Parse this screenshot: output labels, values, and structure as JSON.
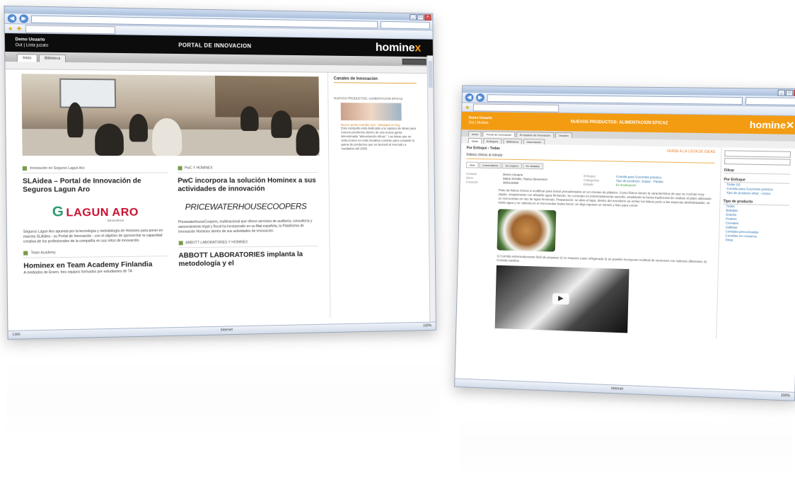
{
  "window1": {
    "user_name": "Demo Usuario",
    "user_links": "Out | Lista juzato",
    "portal_title": "PORTAL DE INNOVACION",
    "logo": "homine",
    "logo_mark": "x",
    "tabs": [
      "Inicio",
      "Biblioteca"
    ],
    "status_left": "Listo",
    "status_zone": "Internet",
    "zoom": "100%",
    "col1": {
      "category": "Innovación en Seguros Lagun Aro",
      "title": "SLAidea – Portal de Innovación de Seguros Lagun Aro",
      "brand": "LAGUN ARO",
      "brand_sub": "SEGUROS",
      "text": "Seguros Lagun Aro apuesta por la tecnología y metodología de Hominex para poner en marcha SLAidea - su Portal de Innovación - con el objetivo de aprovechar la capacidad creativa de los profesionales de la compañía en sus retos de innovación.",
      "category2": "Team Academy",
      "title2": "Hominex en Team Academy Finlandia",
      "text2": "A mediados de Enero, tres equipos formados por estudiantes de TA"
    },
    "col2": {
      "category": "PwC Y HOMINEX",
      "title": "PwC incorpora la solución Hominex a sus actividades de innovación",
      "brand": "PRICEWATERHOUSECOOPERS",
      "text": "PricewaterhouseCoopers, multinacional que ofrece servicios de auditoría, consultoría y asesoramiento legal y fiscal ha incorporado en su filial española, la Plataforma de Innovación Hominex dentro de sus actividades de innovación.",
      "category2": "ABBOTT LABORATORIES Y HOMINEX",
      "title2": "ABBOTT LABORATORIES implanta la metodología y el"
    },
    "sidebar": {
      "title": "Canales de Innovación",
      "item": "NUEVOS PRODUCTOS: ALIMENTACION EFICAZ",
      "link": "Nuevo punto Cambio Aún - Nevaqué es hoy",
      "text": "Esta campaña está dedicada a la captura de ideas para nuevos productos dentro de una nueva gama denominada \"alimentación eficaz\". Las ideas que se seleccionen en esta iniciativa cuentan para competir la gama de productos que se lanzará al mercado a mediados del 2009."
    }
  },
  "window2": {
    "user_name": "Demo Usuario",
    "user_links": "Out | Mislista",
    "portal_title": "NUEVOS PRODUCTOS: ALIMENTACION EFICAZ",
    "logo": "homine",
    "tabs": [
      "Inicio",
      "Portal de Innovación",
      "El espacio de innovación",
      "Desafío"
    ],
    "subtabs": [
      "Ideas",
      "Enfoques",
      "Biblioteca",
      "Información"
    ],
    "crumb": "Por Enfoque › Todas",
    "crumb_right": "VERSE A LA LISTA DE IDEAS",
    "idea_title": "Fideos chinos al minuto",
    "mini_tabs": [
      "Idea",
      "Comentarios",
      "En espera",
      "En detalles"
    ],
    "fields": [
      {
        "label": "Creador",
        "value": "Demo Usuario",
        "label2": "Enfoque",
        "value2": "Comida para Gourmets práctica"
      },
      {
        "label": "Otros",
        "value": "Maria Scholtz, Rama Stevenson",
        "label2": "Categorías",
        "value2": "Tipo de producto: Sopas · Pastas"
      },
      {
        "label": "Creación",
        "value": "30/01/2009",
        "label2": "Estado",
        "value2": "En Evaluación"
      }
    ],
    "description": "Plato de fideos chinos a modificar para tomar precalentados en un envase de plástico. Como fideos tienen la característica de que se cocinan muy rápido, simplemente con añadirle agua hirviendo. Su cocinado es extremadamente sencillo, ampliando la forma tradicional de realizar el plato utilizando un microondas en vez de agua hirviendo. Preparación: se abre el tapa, dentro del envoltorio se echan los fideos junto a las especias deshidratadas, se vierte agua y se calienta en el microondas hasta hervir, se deja reposar un minuto y listo para comer.",
    "more_text": "1) Comida extremadamente fácil de preparar 2) no requiere estar refrigerada 3) se pueden incorporar multitud de versiones con sabores diferentes 4) Comida nutritiva",
    "sidebar": {
      "filter_title": "Filtrar",
      "enfoque_title": "Por Enfoque",
      "enfoque_items": [
        "Todas (4)",
        "Comida para Gourmets práctica",
        "Tipo de producto efraz - Activo"
      ],
      "tipo_title": "Tipo de producto",
      "tipo_items": [
        "Todas",
        "Bebidas",
        "Snacks",
        "Postres",
        "Cereales",
        "Galletas",
        "Comidas precocinadas",
        "Comidas en conserva",
        "Otras"
      ]
    },
    "status_zone": "Internet",
    "zoom": "100%"
  }
}
